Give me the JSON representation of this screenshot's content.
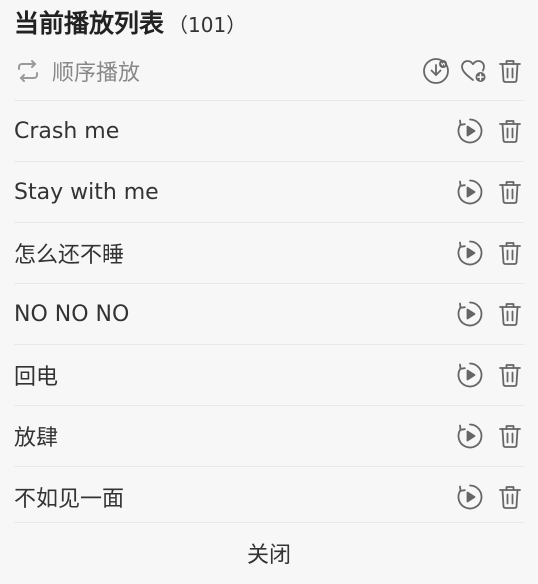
{
  "header": {
    "title": "当前播放列表",
    "count": "（101）"
  },
  "mode": {
    "label": "顺序播放",
    "icon": "repeat-icon"
  },
  "header_icons": [
    "download-icon",
    "favorite-add-icon",
    "trash-icon"
  ],
  "songs": [
    {
      "title": "Crash me"
    },
    {
      "title": "Stay with me"
    },
    {
      "title": "怎么还不睡"
    },
    {
      "title": "NO NO NO"
    },
    {
      "title": "回电"
    },
    {
      "title": "放肆"
    },
    {
      "title": "不如见一面"
    }
  ],
  "row_icons": [
    "play-next-icon",
    "trash-icon"
  ],
  "footer": {
    "close_label": "关闭"
  }
}
